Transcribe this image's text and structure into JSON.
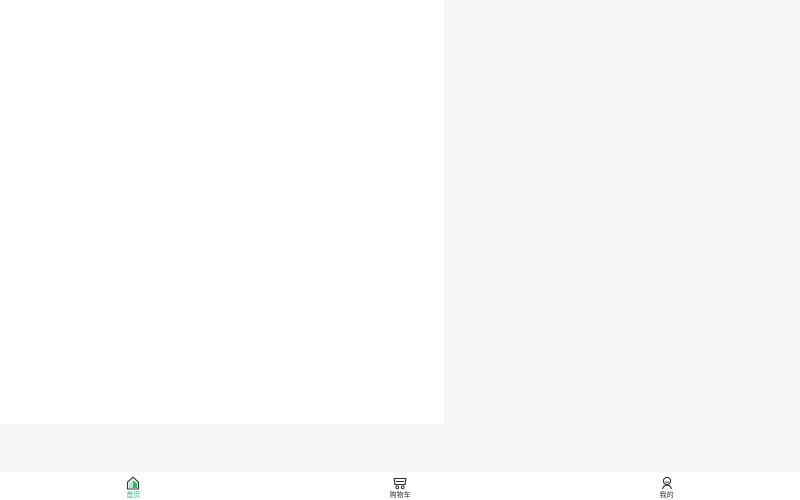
{
  "tabbar": {
    "items": [
      {
        "label": "首页",
        "icon": "home-icon",
        "active": true
      },
      {
        "label": "购物车",
        "icon": "cart-icon",
        "active": false
      },
      {
        "label": "我的",
        "icon": "user-icon",
        "active": false
      }
    ]
  },
  "colors": {
    "accent": "#2bb673",
    "text": "#333333",
    "background": "#f4f5f5",
    "panel": "#ffffff"
  }
}
